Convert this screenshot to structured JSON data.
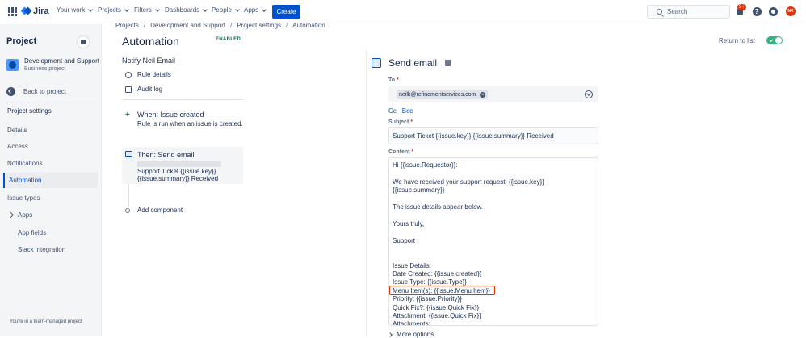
{
  "topnav": {
    "product": "Jira",
    "items": [
      {
        "label": "Your work"
      },
      {
        "label": "Projects"
      },
      {
        "label": "Filters"
      },
      {
        "label": "Dashboards"
      },
      {
        "label": "People"
      },
      {
        "label": "Apps"
      }
    ],
    "create_label": "Create",
    "search_placeholder": "Search",
    "notification_count": "9+",
    "avatar_initials": "NR"
  },
  "sidebar": {
    "title": "Project",
    "project_name": "Development and Support",
    "project_type": "Business project",
    "back_label": "Back to project",
    "section_title": "Project settings",
    "items": [
      {
        "label": "Details"
      },
      {
        "label": "Access"
      },
      {
        "label": "Notifications"
      },
      {
        "label": "Automation"
      },
      {
        "label": "Issue types"
      },
      {
        "label": "Apps"
      }
    ],
    "sub_items": [
      {
        "label": "App fields"
      },
      {
        "label": "Slack integration"
      }
    ],
    "footer": "You're in a team-managed project"
  },
  "breadcrumb": [
    "Projects",
    "Development and Support",
    "Project settings",
    "Automation"
  ],
  "page": {
    "title": "Automation",
    "status": "ENABLED",
    "rule_name": "Notify Neil Email",
    "rule_details": "Rule details",
    "audit_log": "Audit log",
    "return_label": "Return to list"
  },
  "trigger": {
    "heading": "When: Issue created",
    "description": "Rule is run when an issue is created."
  },
  "action": {
    "heading": "Then: Send email",
    "line1": "Support Ticket {{issue.key}}",
    "line2": "{{issue.summary}} Received"
  },
  "add_component": "Add component",
  "panel": {
    "title": "Send email",
    "to_label": "To",
    "to_value": "neilk@refinementservices.com",
    "cc_label": "Cc",
    "bcc_label": "Bcc",
    "subject_label": "Subject",
    "subject_value": "Support Ticket {{issue.key}} {{issue.summary}} Received",
    "content_label": "Content",
    "content_lines": [
      "Hi {{issue.Requestor}}:",
      "",
      "We have received your support request: {{issue.key}}",
      "{{issue.summary}}",
      "",
      "The issue details appear below.",
      "",
      "Yours truly,",
      "",
      "Support",
      "",
      "",
      "Issue Details:",
      "Date Created: {{issue.created}}",
      "Issue Type: {{issue.Type}}",
      "Menu  Item(s): {{issue.Menu Item}}",
      "Priority: {{issue.Priority}}",
      "Quick Fix?: {{issue.Quick Fix}}",
      "Attachment: {{issue.Quick Fix}}",
      "Attachments:"
    ],
    "more_options": "More options"
  }
}
